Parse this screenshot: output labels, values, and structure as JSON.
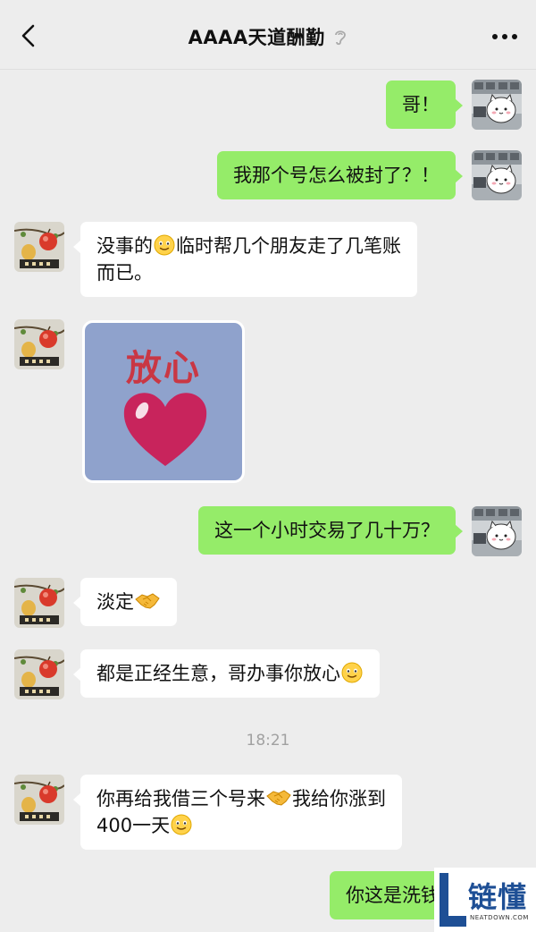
{
  "header": {
    "title": "AAAA天道酬勤"
  },
  "messages": {
    "m1": "哥！",
    "m2": "我那个号怎么被封了？！",
    "m3_part1": "没事的",
    "m3_part2": "临时帮几个朋友走了几笔账",
    "m3_line2": "而已。",
    "m4_sticker_text": "放心",
    "m5": "这一个小时交易了几十万？",
    "m6": "淡定",
    "m7": "都是正经生意，哥办事你放心",
    "m8_part1": "你再给我借三个号来",
    "m8_part2": "我给你涨到",
    "m8_line2": "400一天",
    "m9": "你这是洗钱"
  },
  "timestamp": "18:21",
  "watermark": {
    "brand": "链懂",
    "site": "NEATDOWN.COM"
  },
  "colors": {
    "background": "#ededed",
    "sent_bubble": "#95ec69",
    "received_bubble": "#ffffff",
    "watermark": "#1e4f95"
  },
  "icons": [
    "back-arrow-icon",
    "ear-icon",
    "more-dots-icon",
    "smile-emoji-icon",
    "handshake-emoji-icon",
    "heart-icon"
  ]
}
